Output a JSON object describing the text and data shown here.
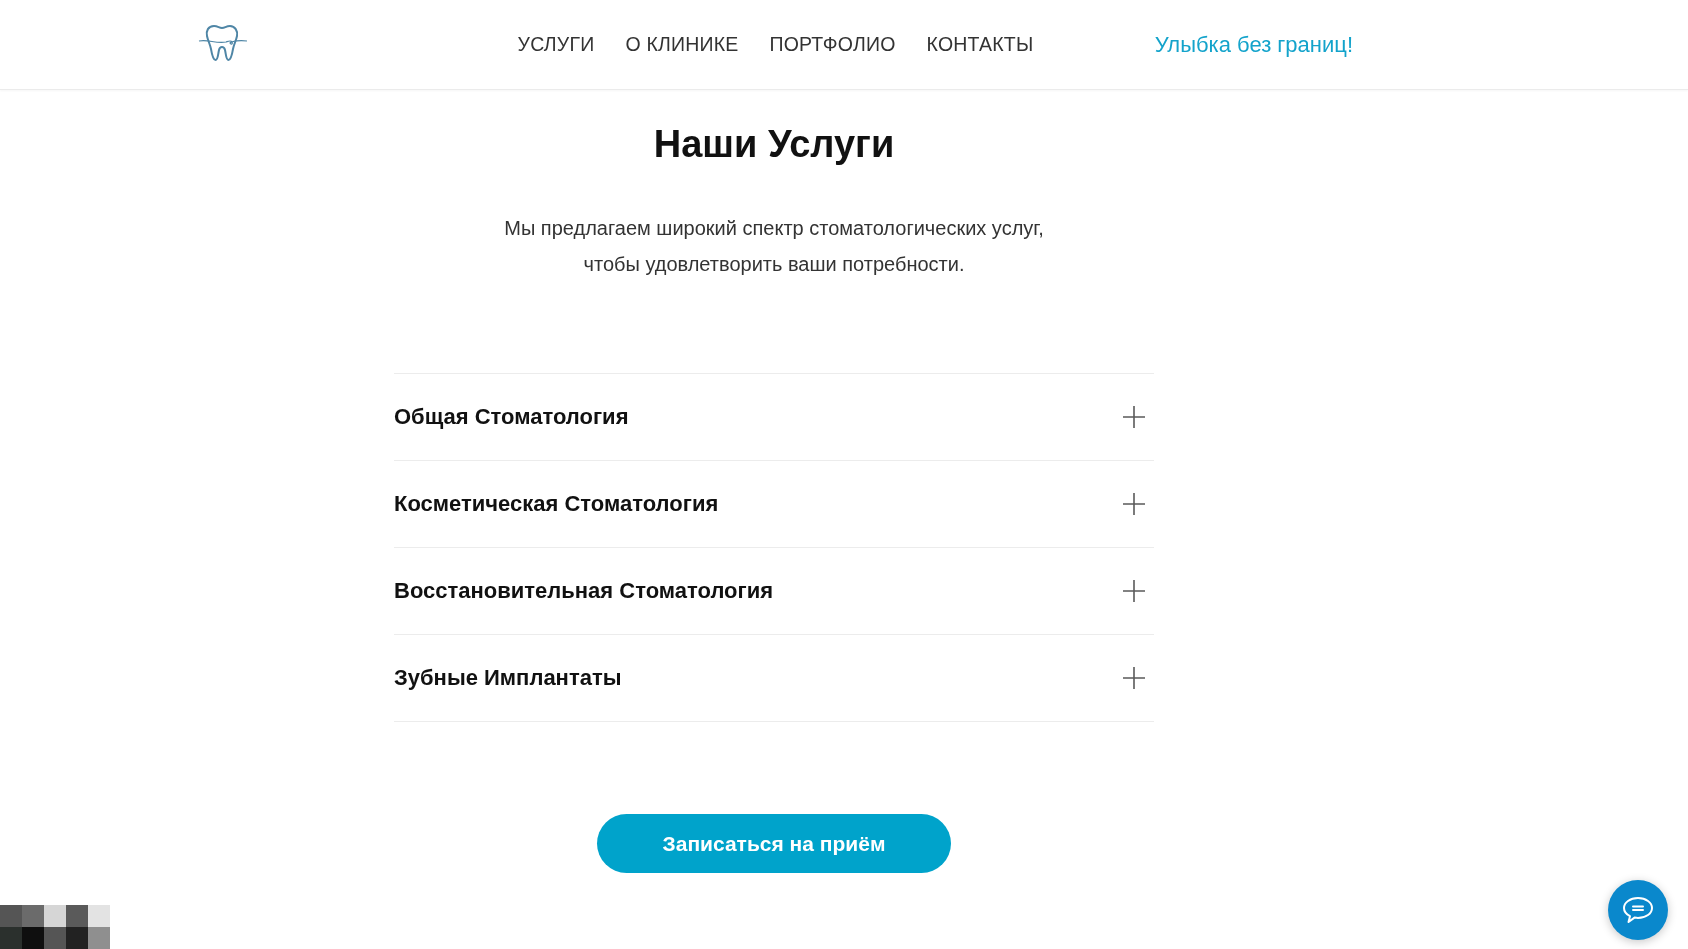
{
  "header": {
    "nav": [
      {
        "label": "УСЛУГИ"
      },
      {
        "label": "О КЛИНИКЕ"
      },
      {
        "label": "ПОРТФОЛИО"
      },
      {
        "label": "КОНТАКТЫ"
      }
    ],
    "tagline": "Улыбка без границ!"
  },
  "services": {
    "title": "Наши Услуги",
    "intro": "Мы предлагаем широкий спектр стоматологических услуг,\nчтобы удовлетворить ваши потребности.",
    "items": [
      {
        "title": "Общая Стоматология",
        "expanded": false
      },
      {
        "title": "Косметическая Стоматология",
        "expanded": false
      },
      {
        "title": "Восстановительная Стоматология",
        "expanded": false
      },
      {
        "title": "Зубные Имплантаты",
        "expanded": false
      }
    ]
  },
  "appointment_button": {
    "label": "Записаться на приём"
  }
}
